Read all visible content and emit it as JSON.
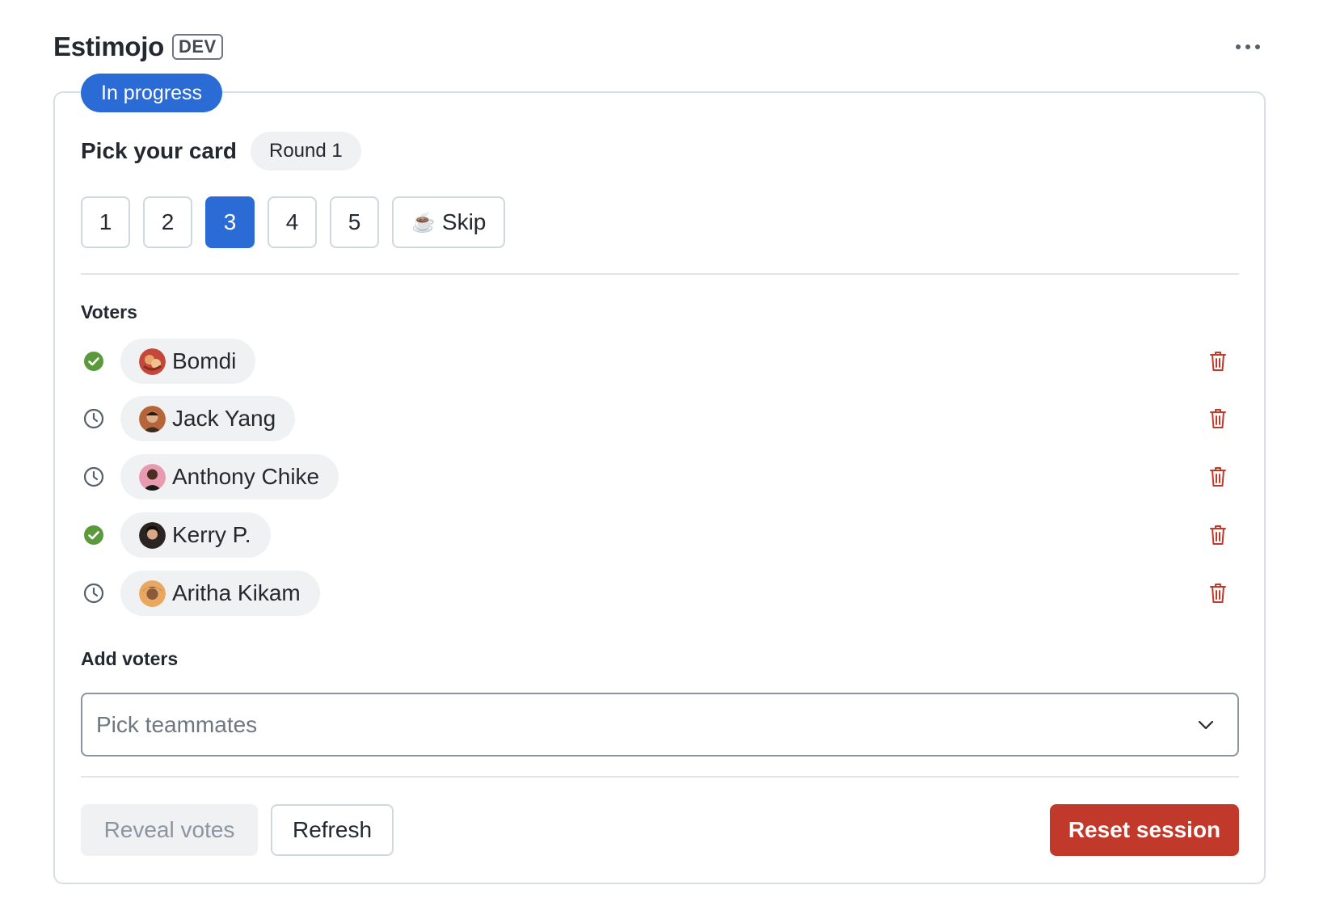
{
  "app": {
    "title": "Estimojo",
    "env_badge": "DEV"
  },
  "session": {
    "status": "In progress",
    "pick_title": "Pick your card",
    "round_label": "Round 1"
  },
  "cards": [
    {
      "label": "1",
      "selected": false
    },
    {
      "label": "2",
      "selected": false
    },
    {
      "label": "3",
      "selected": true
    },
    {
      "label": "4",
      "selected": false
    },
    {
      "label": "5",
      "selected": false
    }
  ],
  "skip_card": {
    "icon": "coffee-cup-icon",
    "glyph": "☕",
    "label": "Skip"
  },
  "voters_section": {
    "title": "Voters",
    "items": [
      {
        "name": "Bomdi",
        "status": "voted"
      },
      {
        "name": "Jack Yang",
        "status": "pending"
      },
      {
        "name": "Anthony Chike",
        "status": "pending"
      },
      {
        "name": "Kerry P.",
        "status": "voted"
      },
      {
        "name": "Aritha Kikam",
        "status": "pending"
      }
    ]
  },
  "add_voters": {
    "title": "Add voters",
    "placeholder": "Pick teammates"
  },
  "actions": {
    "reveal_label": "Reveal votes",
    "refresh_label": "Refresh",
    "reset_label": "Reset session"
  },
  "colors": {
    "accent": "#2b6bd6",
    "danger": "#c0392b",
    "voted": "#5b9a3c",
    "pending": "#57606a"
  }
}
